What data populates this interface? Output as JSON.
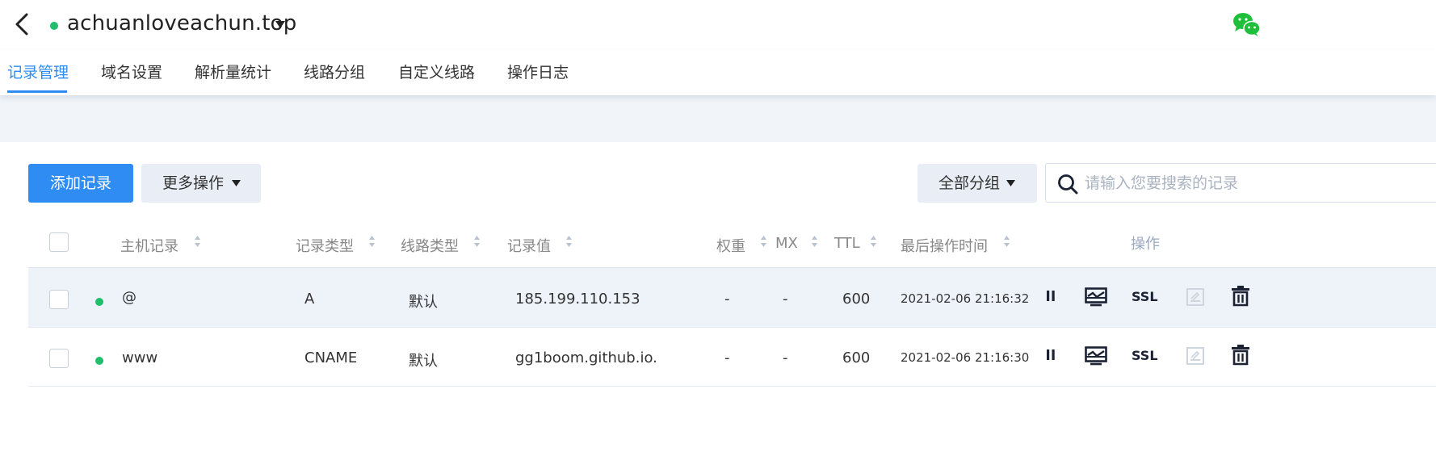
{
  "header": {
    "domain": "achuanloveachun.top",
    "status_color": "#1fbf6b"
  },
  "tabs": [
    {
      "label": "记录管理",
      "active": true
    },
    {
      "label": "域名设置"
    },
    {
      "label": "解析量统计"
    },
    {
      "label": "线路分组"
    },
    {
      "label": "自定义线路"
    },
    {
      "label": "操作日志"
    }
  ],
  "toolbar": {
    "add_label": "添加记录",
    "more_label": "更多操作",
    "group_label": "全部分组",
    "search_placeholder": "请输入您要搜索的记录"
  },
  "table": {
    "columns": {
      "host": "主机记录",
      "type": "记录类型",
      "line": "线路类型",
      "value": "记录值",
      "weight": "权重",
      "mx": "MX",
      "ttl": "TTL",
      "time": "最后操作时间",
      "ops": "操作"
    },
    "rows": [
      {
        "host": "@",
        "type": "A",
        "line": "默认",
        "value": "185.199.110.153",
        "weight": "-",
        "mx": "-",
        "ttl": "600",
        "time": "2021-02-06 21:16:32",
        "ssl": "SSL"
      },
      {
        "host": "www",
        "type": "CNAME",
        "line": "默认",
        "value": "gg1boom.github.io.",
        "weight": "-",
        "mx": "-",
        "ttl": "600",
        "time": "2021-02-06 21:16:30",
        "ssl": "SSL"
      }
    ]
  },
  "colors": {
    "accent": "#2f8cf3",
    "status_enabled": "#1fbf6b",
    "row_highlight": "#eef2f9"
  }
}
